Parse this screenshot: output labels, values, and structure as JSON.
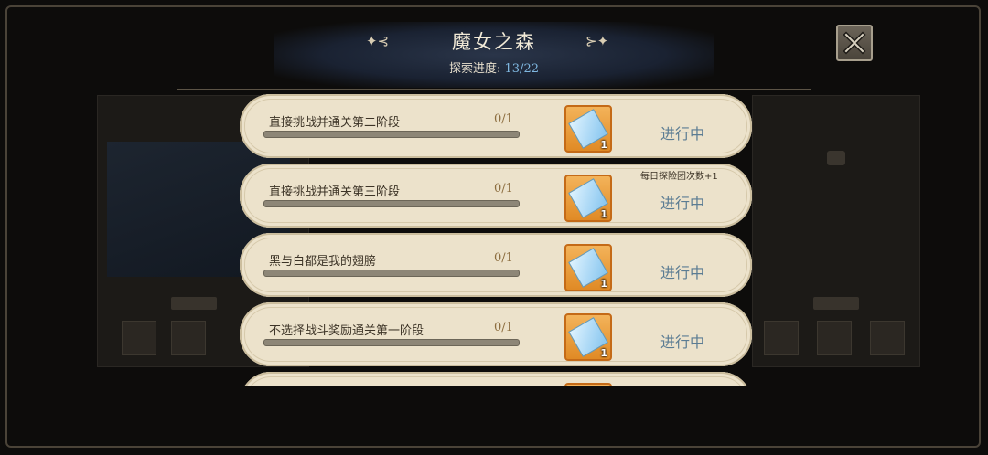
{
  "header": {
    "title": "魔女之森",
    "progress_label": "探索进度: ",
    "progress_value": "13/22",
    "deco_left": "✦⊰",
    "deco_right": "⊱✦"
  },
  "close_icon": "close-x-icon",
  "tasks": [
    {
      "name": "直接挑战并通关第二阶段",
      "count": "0/1",
      "progress": 0,
      "reward_qty": "1",
      "status": "进行中",
      "bonus": ""
    },
    {
      "name": "直接挑战并通关第三阶段",
      "count": "0/1",
      "progress": 0,
      "reward_qty": "1",
      "status": "进行中",
      "bonus": "每日探险团次数+1"
    },
    {
      "name": "黑与白都是我的翅膀",
      "count": "0/1",
      "progress": 0,
      "reward_qty": "1",
      "status": "进行中",
      "bonus": ""
    },
    {
      "name": "不选择战斗奖励通关第一阶段",
      "count": "0/1",
      "progress": 0,
      "reward_qty": "1",
      "status": "进行中",
      "bonus": ""
    }
  ],
  "colors": {
    "accent_blue": "#7fb7e0",
    "card_bg": "#ece2cb",
    "reward_orange": "#e08a25",
    "status_text": "#5b7c93"
  }
}
